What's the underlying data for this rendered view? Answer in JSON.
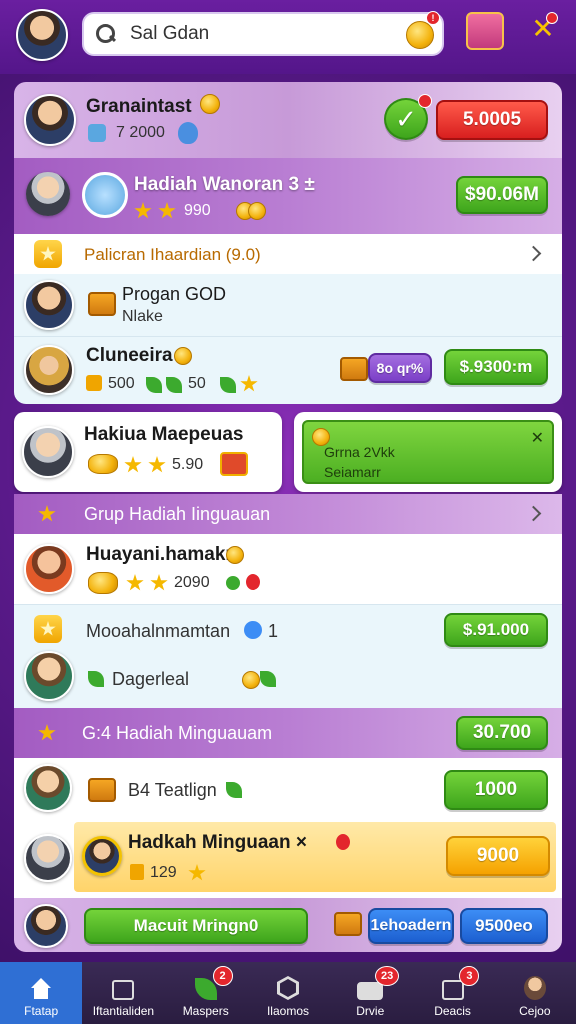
{
  "header": {
    "search_text": "Sal Gdan",
    "notif_badge": "!"
  },
  "profile": {
    "name": "Granaintast",
    "stats": "7 2000",
    "badge_value": "5.0005"
  },
  "rows": {
    "weekly": {
      "title": "Hadiah Wanoran 3 ±",
      "value": "990",
      "button": "$90.06M"
    },
    "section1": {
      "label": "Palicran Ihaardian (9.0)"
    },
    "progan": {
      "name": "Progan GOD",
      "sub": "Nlake"
    },
    "cluneeira": {
      "name": "Cluneeira",
      "stats": "500",
      "stats2": "50",
      "pill": "8o qr%",
      "button": "$.9300:m"
    },
    "hakiua": {
      "name": "Hakiua Maepeuas",
      "stats": "5.90"
    },
    "notice": {
      "line1": "Grrna 2Vkk",
      "line2": "Seiamarr"
    },
    "section2": {
      "label": "Grup Hadiah Iinguauan"
    },
    "huayan": {
      "name": "Huayani.hamakn",
      "stats": "2090"
    },
    "moodahe": {
      "name": "Mooahalnmamtan",
      "num": "1",
      "button": "$.91.000"
    },
    "dagerlial": {
      "name": "Dagerleal"
    },
    "section3": {
      "label": "G:4 Hadiah Minguauam",
      "button": "30.700"
    },
    "teatlign": {
      "name": "B4 Teatlign",
      "button": "1000"
    },
    "hadkah": {
      "name": "Hadkah Minguaan ×",
      "value": "129",
      "button": "9000"
    },
    "footer_row": {
      "btn_green": "Macuit Mringn0",
      "btn_purple": "1ehoadern",
      "btn_blue": "9500eo"
    }
  },
  "tabs": [
    {
      "label": "Ftatap",
      "icon": "home-icon"
    },
    {
      "label": "Iftantialiden",
      "icon": "box-icon"
    },
    {
      "label": "Maspers",
      "icon": "leaf-icon",
      "badge": "2"
    },
    {
      "label": "Ilaomos",
      "icon": "hexagon-icon"
    },
    {
      "label": "Drvie",
      "icon": "chat-icon",
      "badge": "23"
    },
    {
      "label": "Deacis",
      "icon": "box-icon",
      "badge": "3"
    },
    {
      "label": "Cejoo",
      "icon": "person-icon"
    }
  ]
}
